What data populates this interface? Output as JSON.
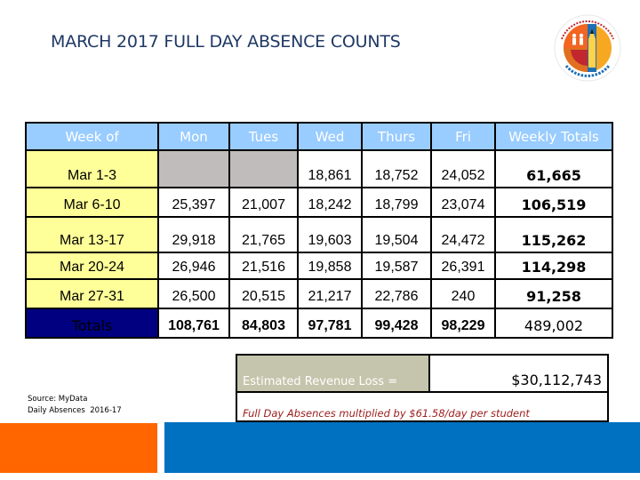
{
  "title": "MARCH 2017 FULL DAY ABSENCE COUNTS",
  "logo": {
    "icon": "lausd-pupil-services-seal",
    "text_top": "LOS ANGELES UNIFIED SCHOOL DISTRICT",
    "text_bottom": "PUPIL SERVICES"
  },
  "table": {
    "headers": [
      "Week of",
      "Mon",
      "Tues",
      "Wed",
      "Thurs",
      "Fri",
      "Weekly Totals"
    ],
    "rows": [
      {
        "week": "Mar 1-3",
        "mon": "",
        "tues": "",
        "wed": "18,861",
        "thurs": "18,752",
        "fri": "24,052",
        "total": "61,665"
      },
      {
        "week": "Mar 6-10",
        "mon": "25,397",
        "tues": "21,007",
        "wed": "18,242",
        "thurs": "18,799",
        "fri": "23,074",
        "total": "106,519"
      },
      {
        "week": "Mar 13-17",
        "mon": "29,918",
        "tues": "21,765",
        "wed": "19,603",
        "thurs": "19,504",
        "fri": "24,472",
        "total": "115,262"
      },
      {
        "week": "Mar 20-24",
        "mon": "26,946",
        "tues": "21,516",
        "wed": "19,858",
        "thurs": "19,587",
        "fri": "26,391",
        "total": "114,298"
      },
      {
        "week": "Mar 27-31",
        "mon": "26,500",
        "tues": "20,515",
        "wed": "21,217",
        "thurs": "22,786",
        "fri": "240",
        "total": "91,258"
      }
    ],
    "totals": {
      "label": "Totals",
      "mon": "108,761",
      "tues": "84,803",
      "wed": "97,781",
      "thurs": "99,428",
      "fri": "98,229",
      "total": "489,002"
    }
  },
  "revenue": {
    "label": "Estimated Revenue Loss =",
    "value": "$30,112,743",
    "note": "Full Day Absences multiplied by $61.58/day per student"
  },
  "source": {
    "line1": "Source: MyData",
    "line2": "Daily Absences  2016-17"
  },
  "colors": {
    "header_bg": "#99ccff",
    "week_bg": "#ffff99",
    "totals_bg": "#000080",
    "no_school_bg": "#c0bcbc",
    "revenue_label_bg": "#c4c5ac",
    "accent_orange": "#ff6600",
    "accent_blue": "#0070c0"
  }
}
